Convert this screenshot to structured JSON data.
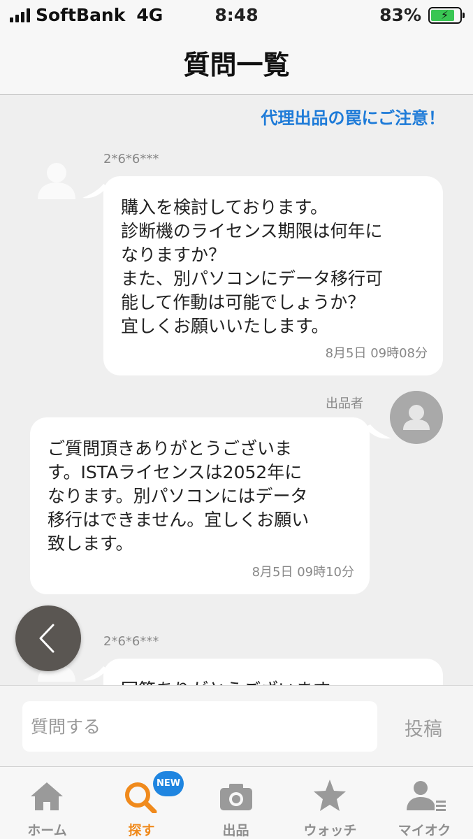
{
  "status_bar": {
    "carrier": "SoftBank",
    "network": "4G",
    "time": "8:48",
    "battery_percent": "83%",
    "battery_level": 0.83
  },
  "header": {
    "title": "質問一覧"
  },
  "warning_link": "代理出品の罠にご注意！",
  "messages": [
    {
      "author": "2*6*6***",
      "side": "left",
      "text": "購入を検討しております。\n診断機のライセンス期限は何年に\nなりますか？\nまた、別パソコンにデータ移行可\n能して作動は可能でしょうか？\n宜しくお願いいたします。",
      "date": "8月5日 09時08分"
    },
    {
      "author": "出品者",
      "side": "right",
      "text": "ご質問頂きありがとうございま\nす。ISTAライセンスは2052年に\nなります。別パソコンにはデータ\n移行はできません。宜しくお願い\n致します。",
      "date": "8月5日 09時10分"
    },
    {
      "author": "2*6*6***",
      "side": "left",
      "text": "回答ありがとうございます"
    }
  ],
  "input": {
    "placeholder": "質問する",
    "post_label": "投稿"
  },
  "tabs": [
    {
      "label": "ホーム",
      "icon": "home-icon"
    },
    {
      "label": "探す",
      "icon": "search-icon",
      "badge": "NEW",
      "active": true
    },
    {
      "label": "出品",
      "icon": "camera-icon"
    },
    {
      "label": "ウォッチ",
      "icon": "star-icon"
    },
    {
      "label": "マイオク",
      "icon": "my-account-icon"
    }
  ],
  "colors": {
    "accent": "#f08a1c",
    "link": "#1e7bd8",
    "badge": "#1f85e0",
    "battery": "#39c653",
    "background": "#efefef"
  }
}
